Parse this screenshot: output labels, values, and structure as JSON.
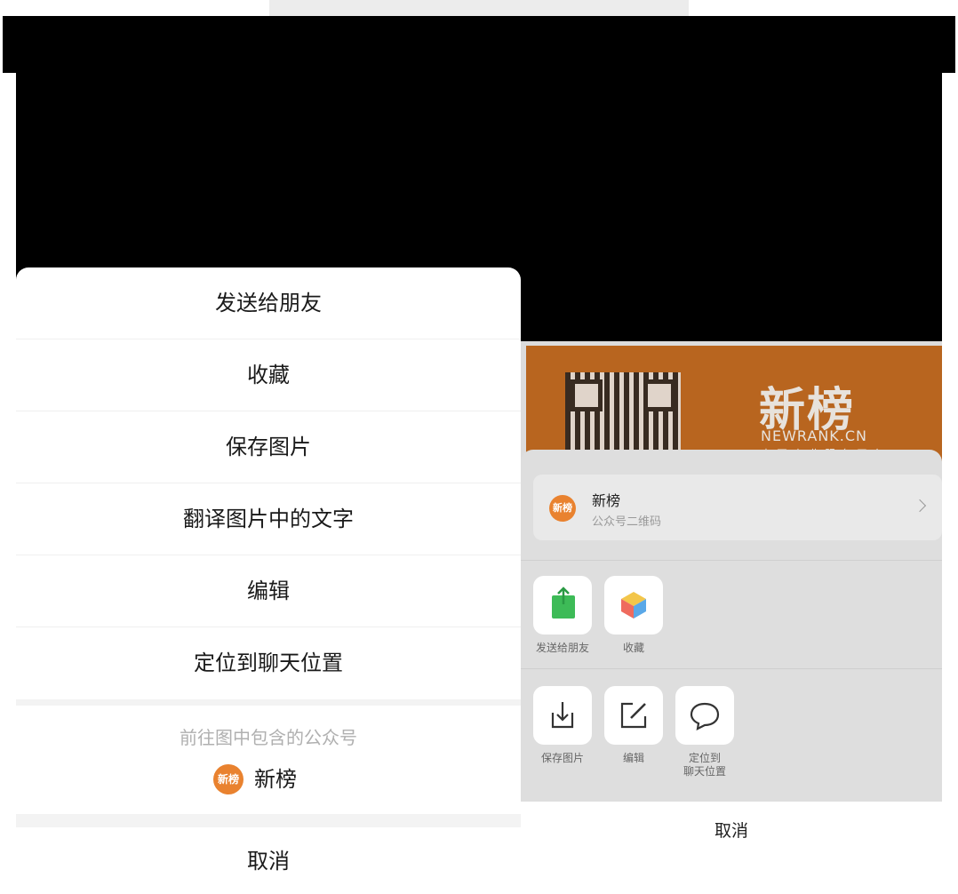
{
  "left_menu": {
    "items": [
      "发送给朋友",
      "收藏",
      "保存图片",
      "翻译图片中的文字",
      "编辑",
      "定位到聊天位置"
    ],
    "goto_label": "前往图中包含的公众号",
    "account_logo_text": "新榜",
    "account_name": "新榜",
    "cancel": "取消"
  },
  "right_screen": {
    "qr_card": {
      "brand": "新榜",
      "url": "NEWRANK.CN",
      "subtitle": "中国商业服务平台"
    },
    "account": {
      "logo_text": "新榜",
      "name": "新榜",
      "desc": "公众号二维码"
    },
    "actions_row1": [
      "发送给朋友",
      "收藏"
    ],
    "actions_row2": [
      "保存图片",
      "编辑",
      "定位到\n聊天位置"
    ],
    "cancel": "取消"
  },
  "colors": {
    "brand_orange": "#e9822f",
    "qr_card_bg": "#b8651f",
    "share_green": "#3dbb57"
  },
  "icons": [
    "share-icon",
    "cube-icon",
    "download-icon",
    "edit-icon",
    "chat-bubble-icon",
    "chevron-right-icon"
  ]
}
